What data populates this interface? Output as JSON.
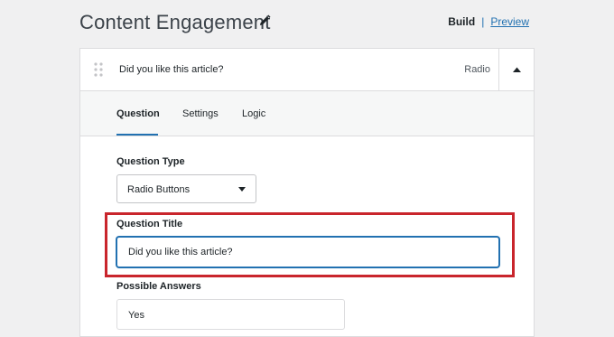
{
  "header": {
    "title": "Content Engagement",
    "edit_icon": "pencil-icon",
    "build_label": "Build",
    "separator": "|",
    "preview_label": "Preview"
  },
  "question": {
    "drag_icon": "drag-handle-icon",
    "title": "Did you like this article?",
    "type": "Radio",
    "collapse_icon": "chevron-up-icon"
  },
  "tabs": [
    {
      "label": "Question",
      "active": true
    },
    {
      "label": "Settings",
      "active": false
    },
    {
      "label": "Logic",
      "active": false
    }
  ],
  "fields": {
    "question_type": {
      "label": "Question Type",
      "value": "Radio Buttons",
      "caret_icon": "caret-down-icon"
    },
    "question_title": {
      "label": "Question Title",
      "value": "Did you like this article?"
    },
    "possible_answers": {
      "label": "Possible Answers",
      "first_value": "Yes"
    }
  },
  "colors": {
    "accent": "#2271b1",
    "highlight": "#c9252c",
    "background": "#f0f0f1"
  }
}
